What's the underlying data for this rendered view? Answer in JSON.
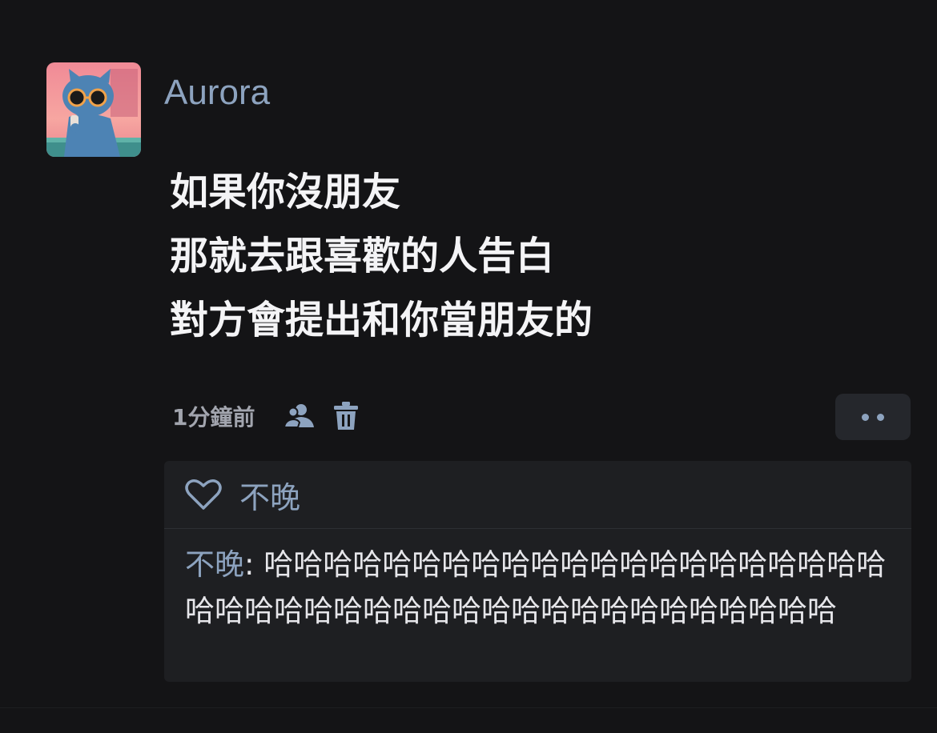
{
  "post": {
    "author": "Aurora",
    "lines": [
      "如果你沒朋友",
      "那就去跟喜歡的人告白",
      "對方會提出和你當朋友的"
    ],
    "timestamp": "1分鐘前"
  },
  "comments": {
    "liked_by": "不晚",
    "items": [
      {
        "author": "不晚",
        "separator": ":",
        "text": "哈哈哈哈哈哈哈哈哈哈哈哈哈哈哈哈哈哈哈哈哈哈哈哈哈哈哈哈哈哈哈哈哈哈哈哈哈哈哈哈哈哈哈"
      }
    ]
  },
  "icons": {
    "tag": "user-tag-icon",
    "delete": "trash-icon",
    "more": "more-dots-icon",
    "like": "heart-outline-icon"
  },
  "colors": {
    "background": "#141416",
    "accent": "#8da3bf",
    "panel": "#1e1f22",
    "text": "#f4f4f6",
    "muted": "#a2a5ae"
  }
}
